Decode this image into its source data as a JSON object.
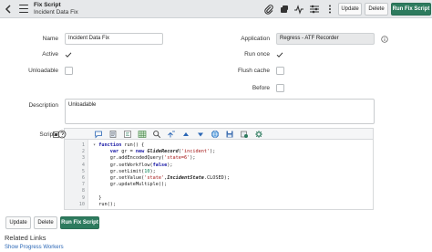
{
  "header": {
    "title": "Fix Script",
    "subtitle": "Incident Data Fix",
    "icons": [
      "paperclip-icon",
      "activity-icon",
      "pulse-icon",
      "sliders-icon",
      "more-icon"
    ],
    "update_label": "Update",
    "delete_label": "Delete",
    "run_label": "Run Fix Script"
  },
  "form": {
    "name_label": "Name",
    "name_value": "Incident Data Fix",
    "application_label": "Application",
    "application_value": "Regress - ATF Recorder",
    "active_label": "Active",
    "active_checked": true,
    "run_once_label": "Run once",
    "run_once_checked": true,
    "unloadable_label": "Unloadable",
    "unloadable_checked": false,
    "flush_cache_label": "Flush cache",
    "flush_cache_checked": false,
    "before_label": "Before",
    "before_checked": false,
    "description_label": "Description",
    "description_value": "Unloadable",
    "script_label": "Script"
  },
  "editor": {
    "toolbar_icons": [
      "comment-icon",
      "code-icon",
      "format-icon",
      "grid-icon",
      "search-icon",
      "replace-icon",
      "up-icon",
      "down-icon",
      "globe-icon",
      "save-icon",
      "bug-icon",
      "settings-icon"
    ],
    "line_numbers": [
      "1",
      "2",
      "3",
      "4",
      "5",
      "6",
      "7",
      "8",
      "9",
      "10",
      "11"
    ]
  },
  "footer": {
    "update_label": "Update",
    "delete_label": "Delete",
    "run_label": "Run Fix Script"
  },
  "related": {
    "title": "Related Links",
    "link": "Show Progress Workers"
  }
}
